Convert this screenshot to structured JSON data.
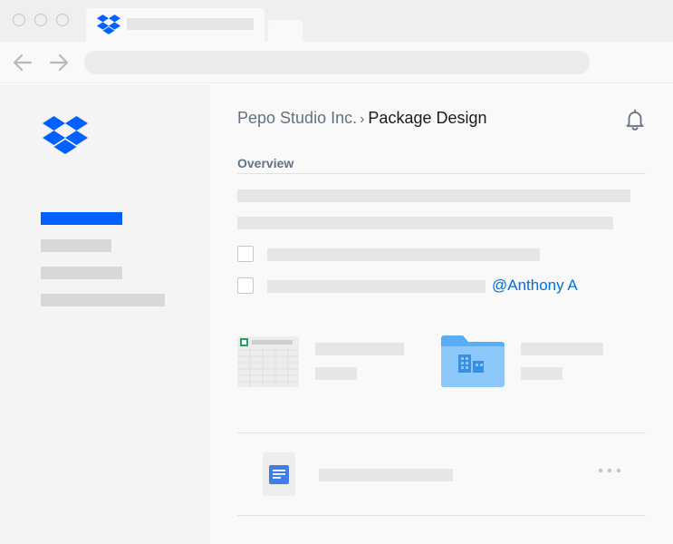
{
  "browser": {
    "tab_icon": "dropbox-icon",
    "back_icon": "arrow-left-icon",
    "forward_icon": "arrow-right-icon"
  },
  "sidebar": {
    "logo_icon": "dropbox-logo-icon",
    "brand_color": "#0061fe"
  },
  "main": {
    "breadcrumb": {
      "parent": "Pepo Studio Inc.",
      "separator": "›",
      "current": "Package Design"
    },
    "notifications_icon": "bell-icon",
    "section_title": "Overview",
    "mention": "@Anthony A",
    "files": [
      {
        "icon": "spreadsheet-icon"
      },
      {
        "icon": "folder-icon"
      }
    ],
    "document_row": {
      "icon": "google-doc-icon",
      "more_icon": "more-options-icon"
    }
  }
}
